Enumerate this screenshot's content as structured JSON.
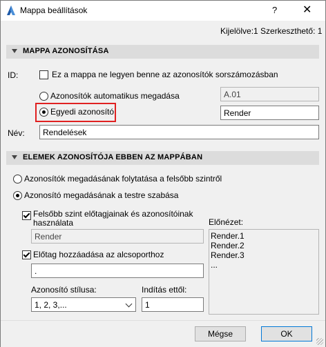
{
  "window": {
    "title": "Mappa beállítások",
    "help_label": "?",
    "close_label": "✕"
  },
  "status_text": "Kijelölve:1 Szerkeszthető: 1",
  "section1": {
    "header": "MAPPA AZONOSÍTÁSA",
    "id_label": "ID:",
    "exclude_checkbox_label": "Ez a mappa ne legyen benne az azonosítók sorszámozásban",
    "exclude_checked": false,
    "auto_radio_label": "Azonosítók automatikus megadása",
    "auto_value": "A.01",
    "custom_radio_label": "Egyedi azonosító",
    "custom_value": "Render",
    "selected": "custom",
    "name_label": "Név:",
    "name_value": "Rendelések"
  },
  "section2": {
    "header": "ELEMEK AZONOSÍTÓJA EBBEN AZ MAPPÁBAN",
    "continue_radio_label": "Azonosítók megadásának folytatása a felsőbb szintről",
    "custom_radio_label": "Azonosító megadásának a testre szabása",
    "selected": "custom",
    "use_upper_label_line1": "Felsőbb szint előtagjainak és azonosítóinak",
    "use_upper_label_line2": "használata",
    "use_upper_checked": true,
    "upper_value": "Render",
    "add_prefix_label": "Előtag hozzáadása az alcsoporthoz",
    "add_prefix_checked": true,
    "prefix_value": ".",
    "style_label": "Azonosító stílusa:",
    "style_value": "1, 2, 3,...",
    "start_label": "Indítás ettől:",
    "start_value": "1",
    "preview_label": "Előnézet:",
    "preview_items": [
      "Render.1",
      "Render.2",
      "Render.3",
      "..."
    ]
  },
  "buttons": {
    "cancel": "Mégse",
    "ok": "OK"
  },
  "colors": {
    "highlight": "#e02020",
    "section_bg": "#dcdcdc",
    "accent": "#0078d7"
  }
}
